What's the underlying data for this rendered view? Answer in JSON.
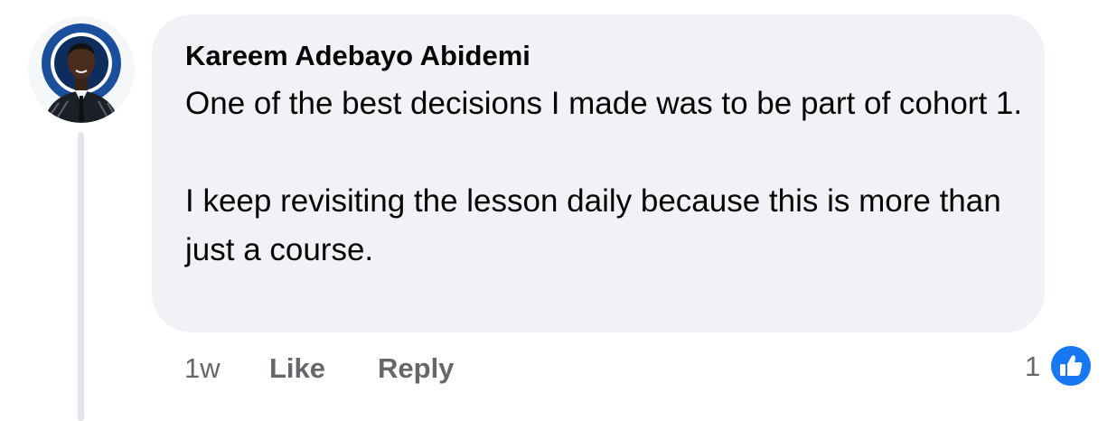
{
  "comment": {
    "author": "Kareem Adebayo Abidemi",
    "paragraphs": [
      "One of the best decisions I made was to be part of cohort 1.",
      "I keep revisiting the lesson daily because this is more than just a course."
    ],
    "timestamp": "1w",
    "like_label": "Like",
    "reply_label": "Reply",
    "reaction_count": "1",
    "reaction_icon": "thumbs-up-icon"
  },
  "colors": {
    "bubble": "#f0f2f5",
    "text": "#050505",
    "meta": "#65676b",
    "like_blue": "#1877f2"
  }
}
